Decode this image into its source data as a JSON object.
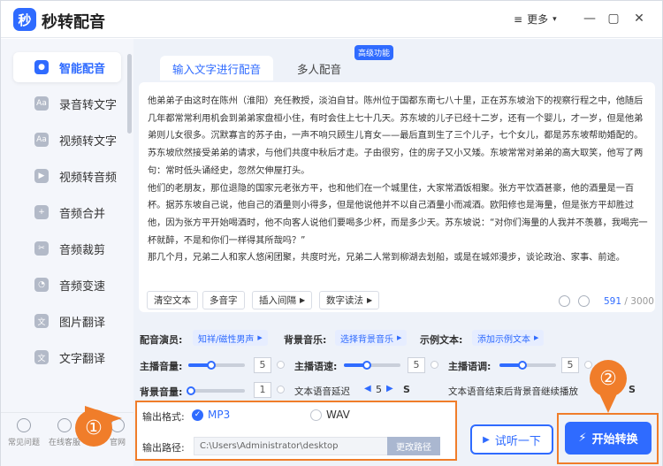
{
  "app": {
    "title": "秒转配音",
    "logo_glyph": "秒",
    "more": "更多"
  },
  "sidebar": {
    "items": [
      {
        "label": "智能配音",
        "active": true
      },
      {
        "label": "录音转文字"
      },
      {
        "label": "视频转文字"
      },
      {
        "label": "视频转音频"
      },
      {
        "label": "音频合并"
      },
      {
        "label": "音频裁剪"
      },
      {
        "label": "音频变速"
      },
      {
        "label": "图片翻译"
      },
      {
        "label": "文字翻译"
      }
    ],
    "footer": [
      "常见问题",
      "在线客服",
      "官网"
    ]
  },
  "tabs": [
    {
      "label": "输入文字进行配音"
    },
    {
      "label": "多人配音"
    }
  ],
  "badge": "高级功能",
  "editor": {
    "text": "他弟弟子由这时在陈州（淮阳）充任教授，淡泊自甘。陈州位于国都东南七八十里，正在苏东坡治下的视察行程之中，他随后几年都常常利用机会到弟弟家盘桓小住，有时会住上七十几天。苏东坡的儿子已经十二岁，还有一个婴儿，才一岁，但是他弟弟则儿女很多。沉默寡言的苏子由，一声不响只顾生儿育女——最后直到生了三个儿子，七个女儿，都是苏东坡帮助婚配的。苏东坡欣然接受弟弟的请求，与他们共度中秋后才走。子由很穷，住的房子又小又矮。东坡常常对弟弟的高大取笑，他写了两句：常时低头诵经史，忽然欠伸屋打头。\n他们的老朋友，那位退隐的国家元老张方平，也和他们在一个城里住，大家常酒饭相聚。张方平饮酒甚豪，他的酒量是一百杯。据苏东坡自己说，他自己的酒量则小得多，但是他说他并不以自己酒量小而减酒。欧阳修也是海量，但是张方平却胜过他，因为张方平开始喝酒时，他不向客人说他们要喝多少杯，而是多少天。苏东坡说：“对你们海量的人我并不羡慕，我喝完一杯就醉，不是和你们一样得其所哉吗？”\n那几个月，兄弟二人和家人悠闲团聚，共度时光，兄弟二人常到柳湖去划船，或是在城郊漫步，谈论政治、家事、前途。",
    "buttons": [
      "清空文本",
      "多音字",
      "插入间隔",
      "数字读法"
    ],
    "count": "591",
    "max": "/ 3000"
  },
  "settings": {
    "voice_label": "配音演员:",
    "voice": "知祥/磁性男声",
    "bgm_label": "背景音乐:",
    "bgm": "选择背景音乐",
    "sample_label": "示例文本:",
    "sample": "添加示例文本",
    "vol_label": "主播音量:",
    "vol": "5",
    "vol_level": 0.4,
    "speed_label": "主播语速:",
    "speed": "5",
    "speed_level": 0.4,
    "pitch_label": "主播语调:",
    "pitch": "5",
    "pitch_level": 0.4,
    "bgvol_label": "背景音量:",
    "bgvol": "1",
    "bgvol_level": 0.05,
    "delay_label": "文本语音延迟",
    "delay": "5",
    "delay_unit": "S",
    "continue_label": "文本语音结束后背景音继续播放",
    "continue_unit": "S"
  },
  "output": {
    "format_label": "输出格式:",
    "mp3": "MP3",
    "wav": "WAV",
    "path_label": "输出路径:",
    "path": "C:\\Users\\Administrator\\desktop",
    "change_path": "更改路径"
  },
  "actions": {
    "try": "试听一下",
    "start": "开始转换"
  },
  "markers": [
    "①",
    "②"
  ],
  "colors": {
    "accent": "#2f6bff",
    "highlight": "#f07d2a"
  }
}
